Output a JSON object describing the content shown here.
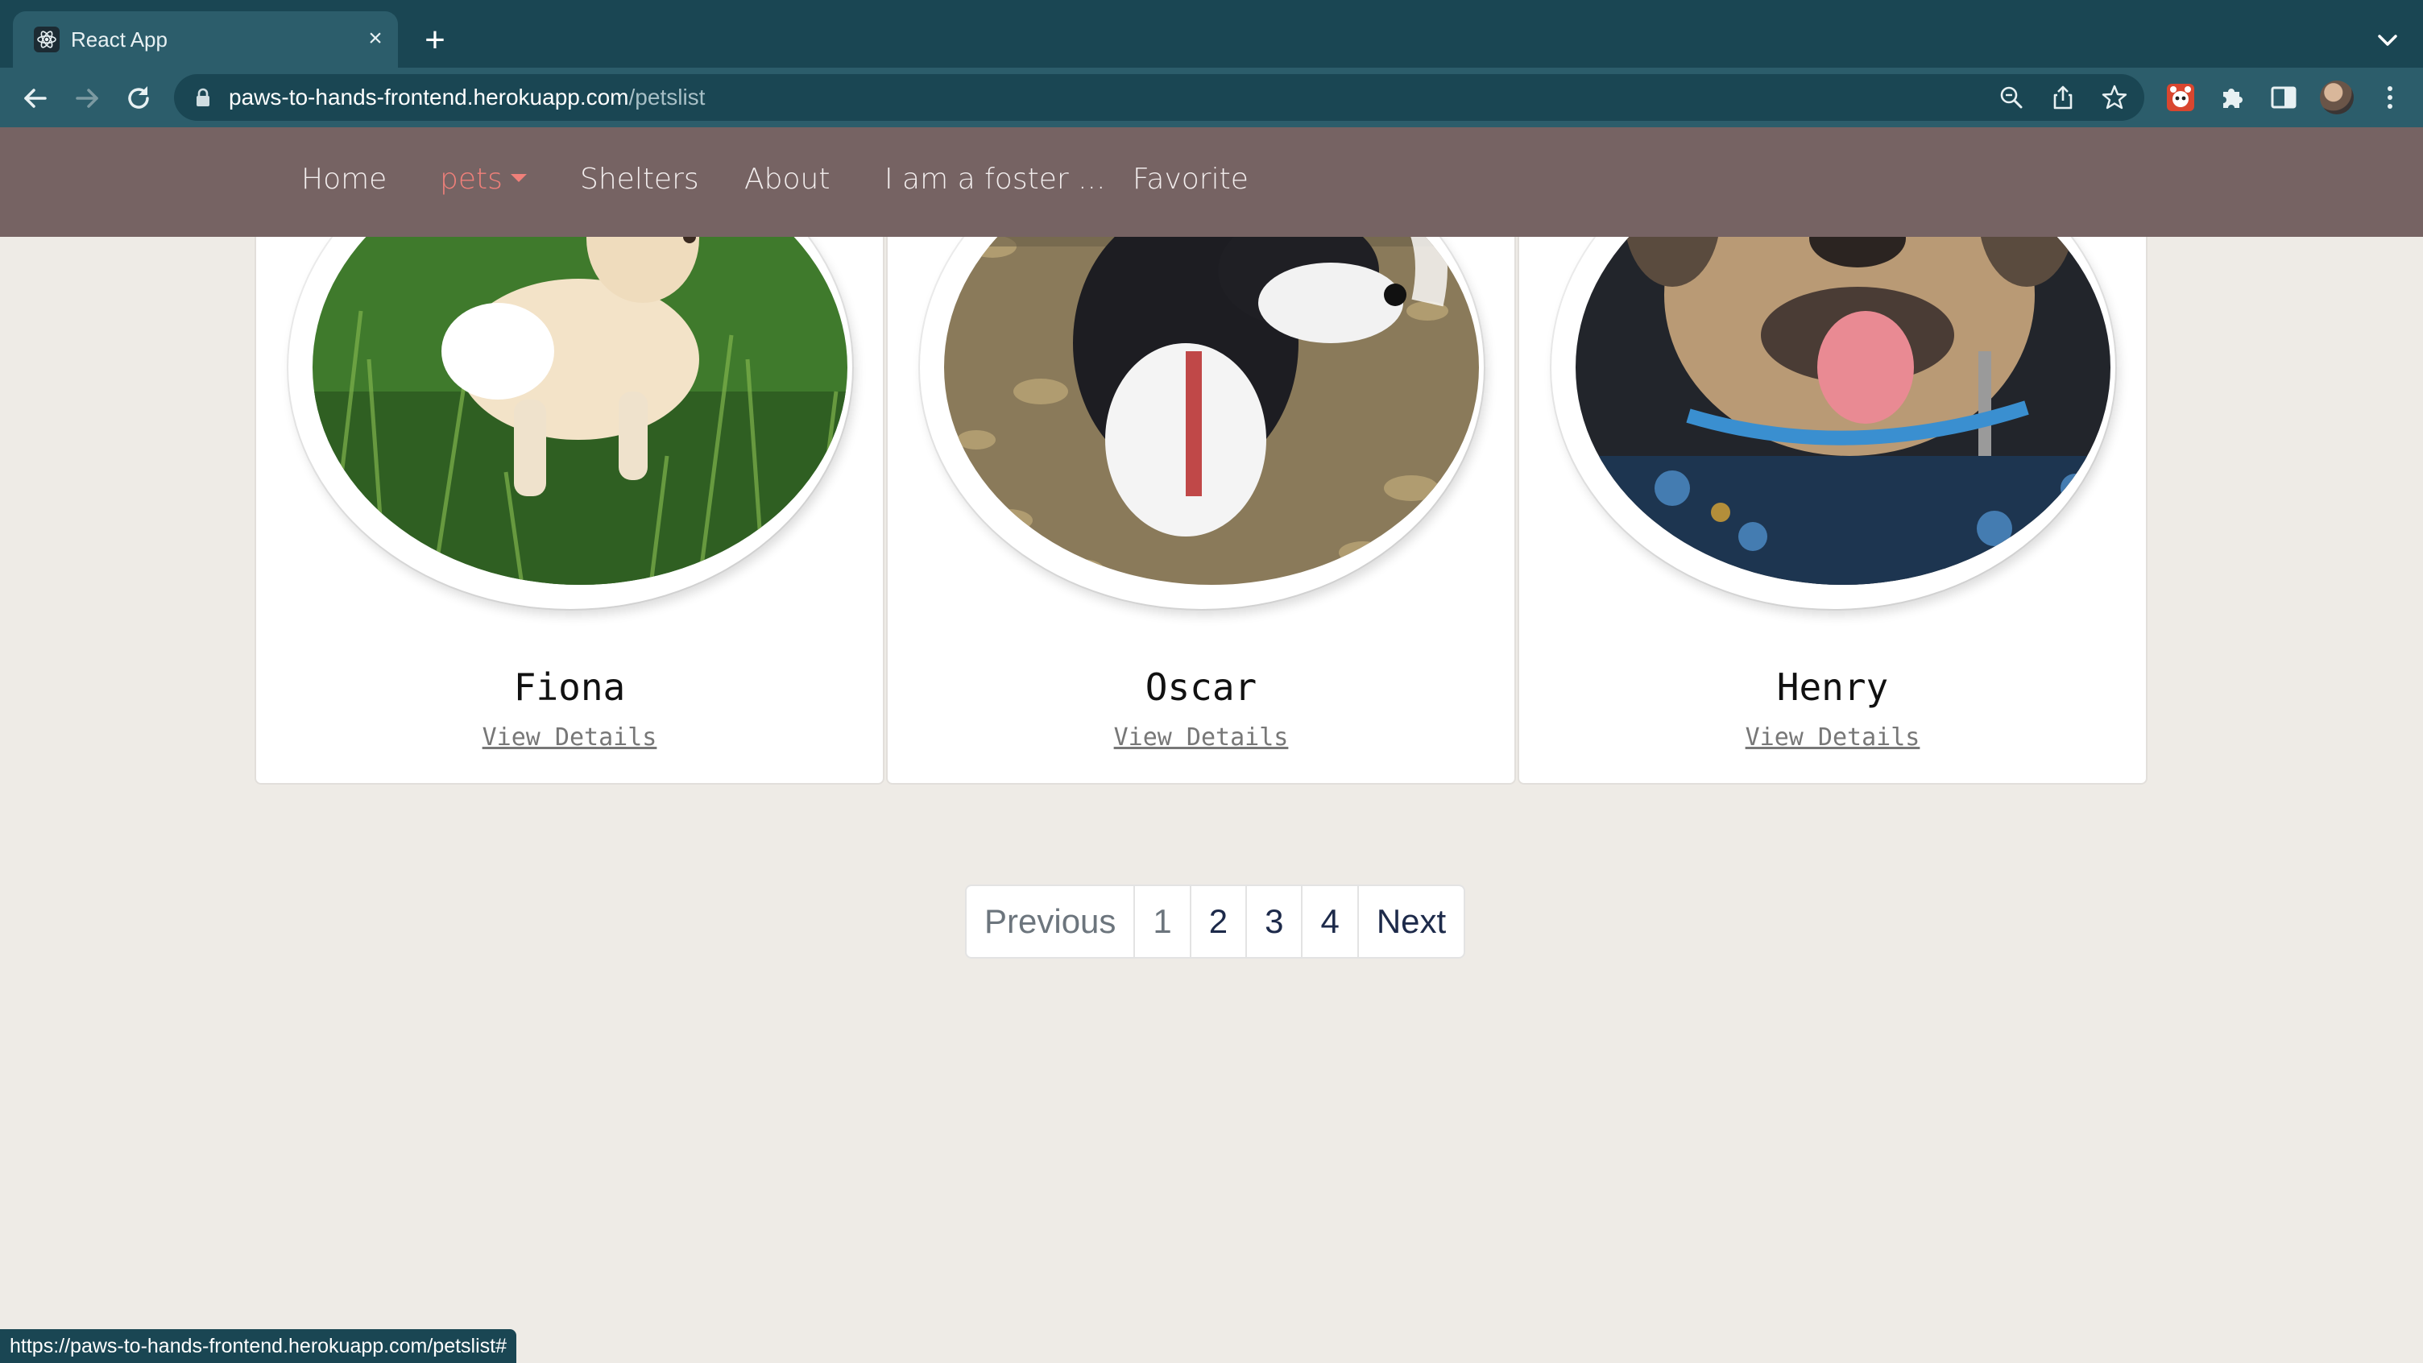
{
  "browser": {
    "tab_title": "React App",
    "url_domain": "paws-to-hands-frontend.herokuapp.com",
    "url_path": "/petslist",
    "status_url": "https://paws-to-hands-frontend.herokuapp.com/petslist#"
  },
  "navbar": {
    "home": "Home",
    "pets": "pets",
    "shelters": "Shelters",
    "about": "About",
    "foster": "I am a foster ...",
    "favorite": "Favorite",
    "active_color": "#f0807a"
  },
  "pets": [
    {
      "name": "Fiona",
      "link": "View Details"
    },
    {
      "name": "Oscar",
      "link": "View Details"
    },
    {
      "name": "Henry",
      "link": "View Details"
    }
  ],
  "pagination": {
    "previous": "Previous",
    "pages": [
      "1",
      "2",
      "3",
      "4"
    ],
    "next": "Next",
    "current": "1"
  },
  "colors": {
    "chrome_dark": "#1a4653",
    "chrome_light": "#2c5d6b",
    "navbar": "#766363",
    "page_bg": "#eeebe6"
  }
}
